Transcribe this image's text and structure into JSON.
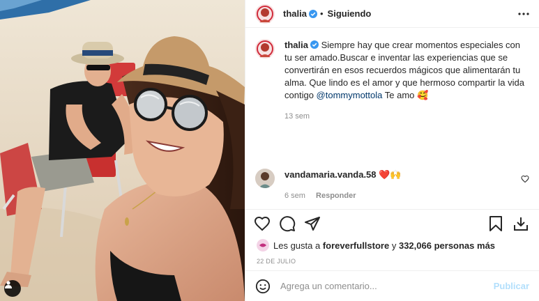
{
  "post": {
    "author": "thalia",
    "follow_status": "Siguiendo",
    "separator": "•",
    "caption_text": "Siempre hay que crear momentos especiales con tu ser amado.Buscar e inventar las experiencias que se convertirán en esos recuerdos mágicos que alimentarán tu alma. Que lindo es el amor y que hermoso compartir la vida contigo",
    "caption_mention": "@tommymottola",
    "caption_tail": "Te amo",
    "caption_emoji": "🥰",
    "caption_age": "13 sem"
  },
  "comment": {
    "author": "vandamaria.vanda.58",
    "text": "❤️🙌",
    "age": "6 sem",
    "reply_label": "Responder"
  },
  "likes": {
    "prefix": "Les gusta a",
    "user": "foreverfullstore",
    "suffix": "y",
    "count": "332,066",
    "suffix2": "personas más"
  },
  "date": "22 DE JULIO",
  "comment_input": {
    "placeholder": "Agrega un comentario...",
    "submit_label": "Publicar"
  },
  "icons": {
    "verified": "verified-badge-icon",
    "more": "more-options-icon",
    "like": "heart-icon",
    "comment": "comment-icon",
    "share": "share-icon",
    "save": "bookmark-icon",
    "download": "download-icon",
    "emoji": "emoji-icon",
    "tag": "user-tag-icon"
  },
  "colors": {
    "text": "#262626",
    "muted": "#8e8e8e",
    "verified": "#3897f0",
    "mention": "#00376b",
    "publish_disabled": "#b2dffc",
    "border": "#efefef"
  }
}
